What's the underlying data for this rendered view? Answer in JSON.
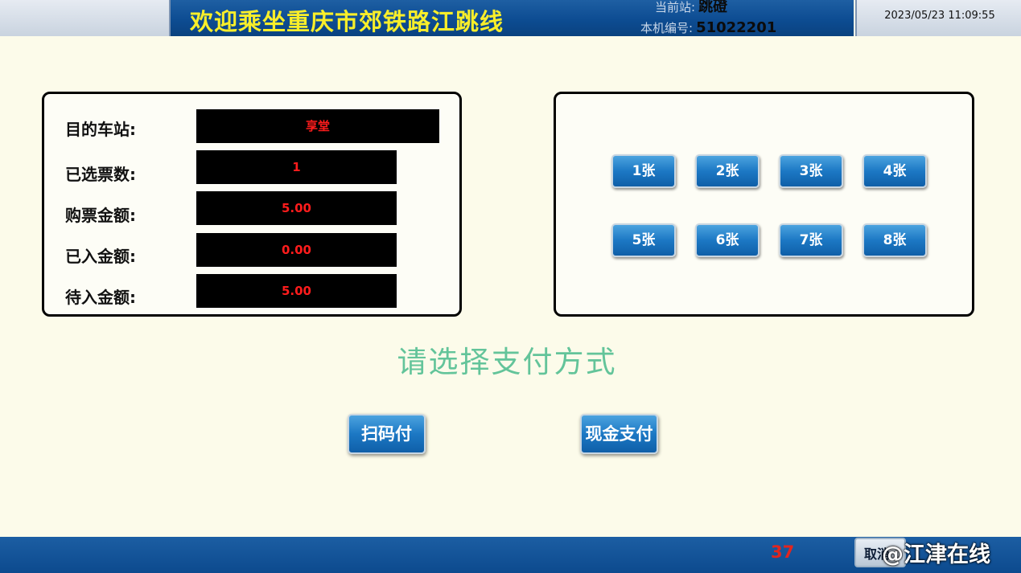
{
  "header": {
    "title": "欢迎乘坐重庆市郊铁路江跳线",
    "current_station_label": "当前站:",
    "current_station": "跳磴",
    "machine_no_label": "本机编号:",
    "machine_no": "51022201",
    "datetime": "2023/05/23 11:09:55"
  },
  "info": {
    "rows": [
      {
        "label": "目的车站:",
        "value": "享堂"
      },
      {
        "label": "已选票数:",
        "value": "1"
      },
      {
        "label": "购票金额:",
        "value": "5.00"
      },
      {
        "label": "已入金额:",
        "value": "0.00"
      },
      {
        "label": "待入金额:",
        "value": "5.00"
      }
    ]
  },
  "tickets": {
    "buttons": [
      "1张",
      "2张",
      "3张",
      "4张",
      "5张",
      "6张",
      "7张",
      "8张"
    ]
  },
  "payment": {
    "prompt": "请选择支付方式",
    "qr_label": "扫码付",
    "cash_label": "现金支付"
  },
  "footer": {
    "countdown": "37",
    "cancel_label": "取消",
    "watermark": "@江津在线"
  },
  "colors": {
    "background": "#fcfbea",
    "header_blue": "#0d4c92",
    "title_yellow": "#f8ee2a",
    "value_red": "#ff1c1c",
    "prompt_green": "#63c49a",
    "button_blue": "#1c78c4"
  }
}
